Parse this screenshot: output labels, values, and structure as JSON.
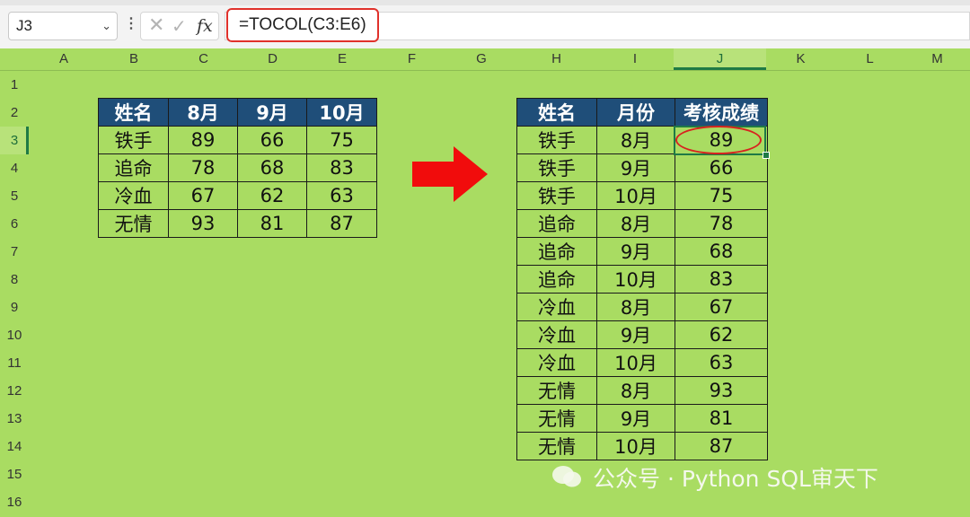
{
  "formula_bar": {
    "name_box": "J3",
    "formula": "=TOCOL(C3:E6)"
  },
  "columns": [
    "A",
    "B",
    "C",
    "D",
    "E",
    "F",
    "G",
    "H",
    "I",
    "J",
    "K",
    "L",
    "M"
  ],
  "rows": [
    "1",
    "2",
    "3",
    "4",
    "5",
    "6",
    "7",
    "8",
    "9",
    "10",
    "11",
    "12",
    "13",
    "14",
    "15",
    "16"
  ],
  "source_table": {
    "headers": [
      "姓名",
      "8月",
      "9月",
      "10月"
    ],
    "rows": [
      [
        "铁手",
        "89",
        "66",
        "75"
      ],
      [
        "追命",
        "78",
        "68",
        "83"
      ],
      [
        "冷血",
        "67",
        "62",
        "63"
      ],
      [
        "无情",
        "93",
        "81",
        "87"
      ]
    ]
  },
  "result_table": {
    "headers": [
      "姓名",
      "月份",
      "考核成绩"
    ],
    "rows": [
      [
        "铁手",
        "8月",
        "89"
      ],
      [
        "铁手",
        "9月",
        "66"
      ],
      [
        "铁手",
        "10月",
        "75"
      ],
      [
        "追命",
        "8月",
        "78"
      ],
      [
        "追命",
        "9月",
        "68"
      ],
      [
        "追命",
        "10月",
        "83"
      ],
      [
        "冷血",
        "8月",
        "67"
      ],
      [
        "冷血",
        "9月",
        "62"
      ],
      [
        "冷血",
        "10月",
        "63"
      ],
      [
        "无情",
        "8月",
        "93"
      ],
      [
        "无情",
        "9月",
        "81"
      ],
      [
        "无情",
        "10月",
        "87"
      ]
    ]
  },
  "selected_cell": {
    "column": "J",
    "row": "3"
  },
  "icons": {
    "arrow": "right-arrow-icon",
    "watermark": "wechat-icon"
  },
  "colors": {
    "sheet_bg": "#a9dc62",
    "header_bg": "#1f4e79",
    "highlight": "#e0312b",
    "selection": "#1f7a45"
  },
  "watermark": "公众号 · Python SQL审天下"
}
